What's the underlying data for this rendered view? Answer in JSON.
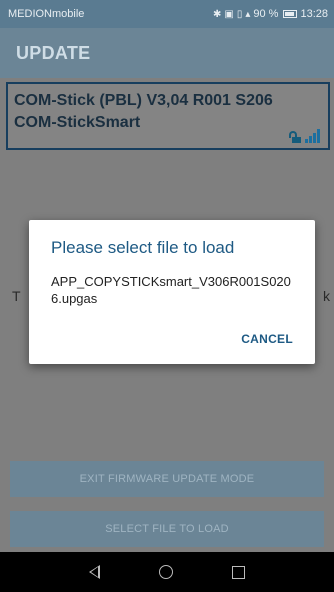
{
  "status_bar": {
    "carrier": "MEDIONmobile",
    "battery": "90 %",
    "time": "13:28"
  },
  "app_bar": {
    "title": "UPDATE"
  },
  "device": {
    "line1": "COM-Stick (PBL) V3,04 R001 S206",
    "line2": "COM-StickSmart",
    "icons": [
      "lock-open-icon",
      "signal-strength-icon"
    ]
  },
  "background_text": {
    "left_char": "T",
    "right_char": "k"
  },
  "buttons": {
    "exit_label": "EXIT FIRMWARE UPDATE MODE",
    "select_label": "SELECT FILE TO LOAD"
  },
  "dialog": {
    "title": "Please select file to load",
    "filename": "APP_COPYSTICKsmart_V306R001S0206.upgas",
    "cancel_label": "CANCEL"
  },
  "colors": {
    "accent": "#1e5a84",
    "app_bar": "#6b8596",
    "card_border": "#173e5e"
  }
}
